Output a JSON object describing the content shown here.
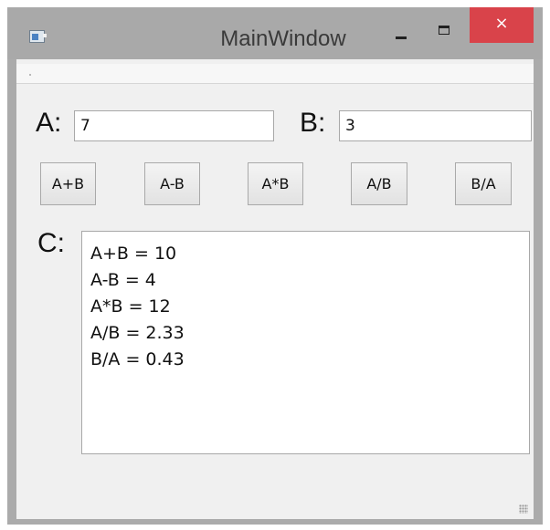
{
  "window": {
    "title": "MainWindow",
    "close_glyph": "×"
  },
  "labels": {
    "a": "A:",
    "b": "B:",
    "c": "C:"
  },
  "inputs": {
    "a_value": "7",
    "b_value": "3"
  },
  "buttons": [
    {
      "label": "A+B"
    },
    {
      "label": "A-B"
    },
    {
      "label": "A*B"
    },
    {
      "label": "A/B"
    },
    {
      "label": "B/A"
    }
  ],
  "output": {
    "lines": [
      "A+B = 10",
      "A-B = 4",
      "A*B = 12",
      "A/B = 2.33",
      "B/A = 0.43"
    ]
  },
  "colors": {
    "close_button": "#d9434a",
    "window_frame": "#ababab",
    "client_background": "#f0f0f0"
  }
}
